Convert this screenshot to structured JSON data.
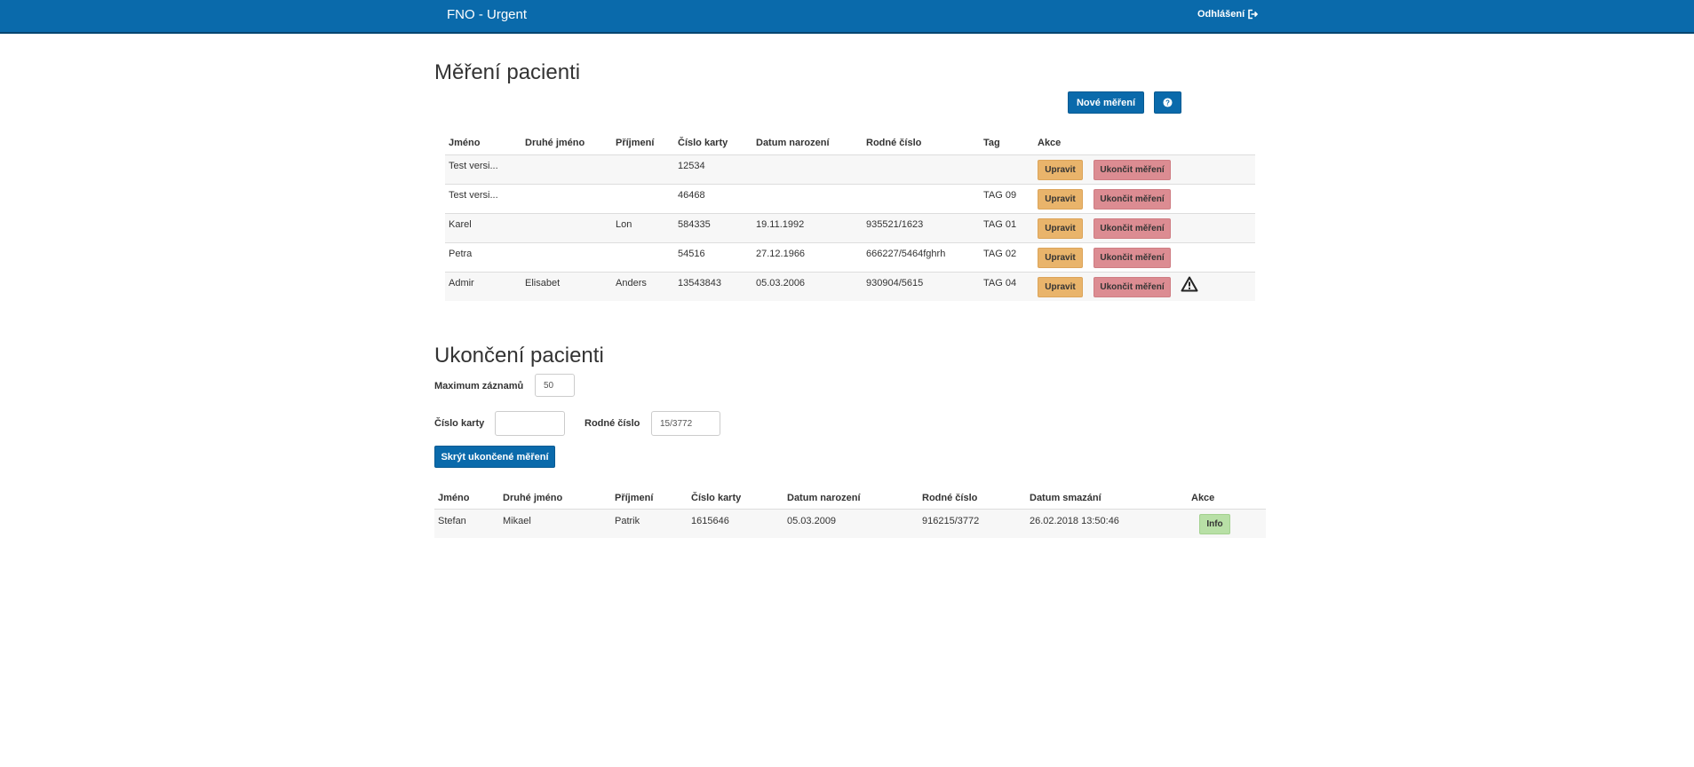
{
  "app": {
    "title": "FNO - Urgent",
    "logout_label": "Odhlášení"
  },
  "measurements": {
    "title": "Měření pacienti",
    "new_button": "Nové měření",
    "help_icon": "question-circle-icon",
    "columns": [
      "Jméno",
      "Druhé jméno",
      "Příjmení",
      "Číslo karty",
      "Datum narození",
      "Rodné číslo",
      "Tag",
      "Akce"
    ],
    "edit_label": "Upravit",
    "end_label": "Ukončit měření",
    "rows": [
      {
        "first": "Test versi...",
        "middle": "",
        "last": "",
        "card": "12534",
        "birth": "",
        "rc": "",
        "tag": ""
      },
      {
        "first": "Test versi...",
        "middle": "",
        "last": "",
        "card": "46468",
        "birth": "",
        "rc": "",
        "tag": "TAG 09"
      },
      {
        "first": "Karel",
        "middle": "",
        "last": "Lon",
        "card": "584335",
        "birth": "19.11.1992",
        "rc": "935521/1623",
        "tag": "TAG 01"
      },
      {
        "first": "Petra",
        "middle": "",
        "last": "",
        "card": "54516",
        "birth": "27.12.1966",
        "rc": "666227/5464fghrh",
        "tag": "TAG 02"
      },
      {
        "first": "Admir",
        "middle": "Elisabet",
        "last": "Anders",
        "card": "13543843",
        "birth": "05.03.2006",
        "rc": "930904/5615",
        "tag": "TAG 04",
        "warning": "warning-triangle-icon"
      }
    ]
  },
  "ended": {
    "title": "Ukončení pacienti",
    "max_label": "Maximum záznamů",
    "max_value": "50",
    "card_label": "Číslo karty",
    "card_value": "",
    "rc_label": "Rodné číslo",
    "rc_value": "15/3772",
    "hide_button": "Skrýt ukončené měření",
    "columns": [
      "Jméno",
      "Druhé jméno",
      "Příjmení",
      "Číslo karty",
      "Datum narození",
      "Rodné číslo",
      "Datum smazání",
      "Akce"
    ],
    "info_label": "Info",
    "rows": [
      {
        "first": "Stefan",
        "middle": "Mikael",
        "last": "Patrik",
        "card": "1615646",
        "birth": "05.03.2009",
        "rc": "916215/3772",
        "deleted": "26.02.2018 13:50:46"
      }
    ]
  },
  "colors": {
    "navbar": "#0a6aab",
    "primary": "#0a6aab",
    "warning": "#e9b46b",
    "danger": "#dc8c92",
    "success": "#b8e0a6"
  }
}
